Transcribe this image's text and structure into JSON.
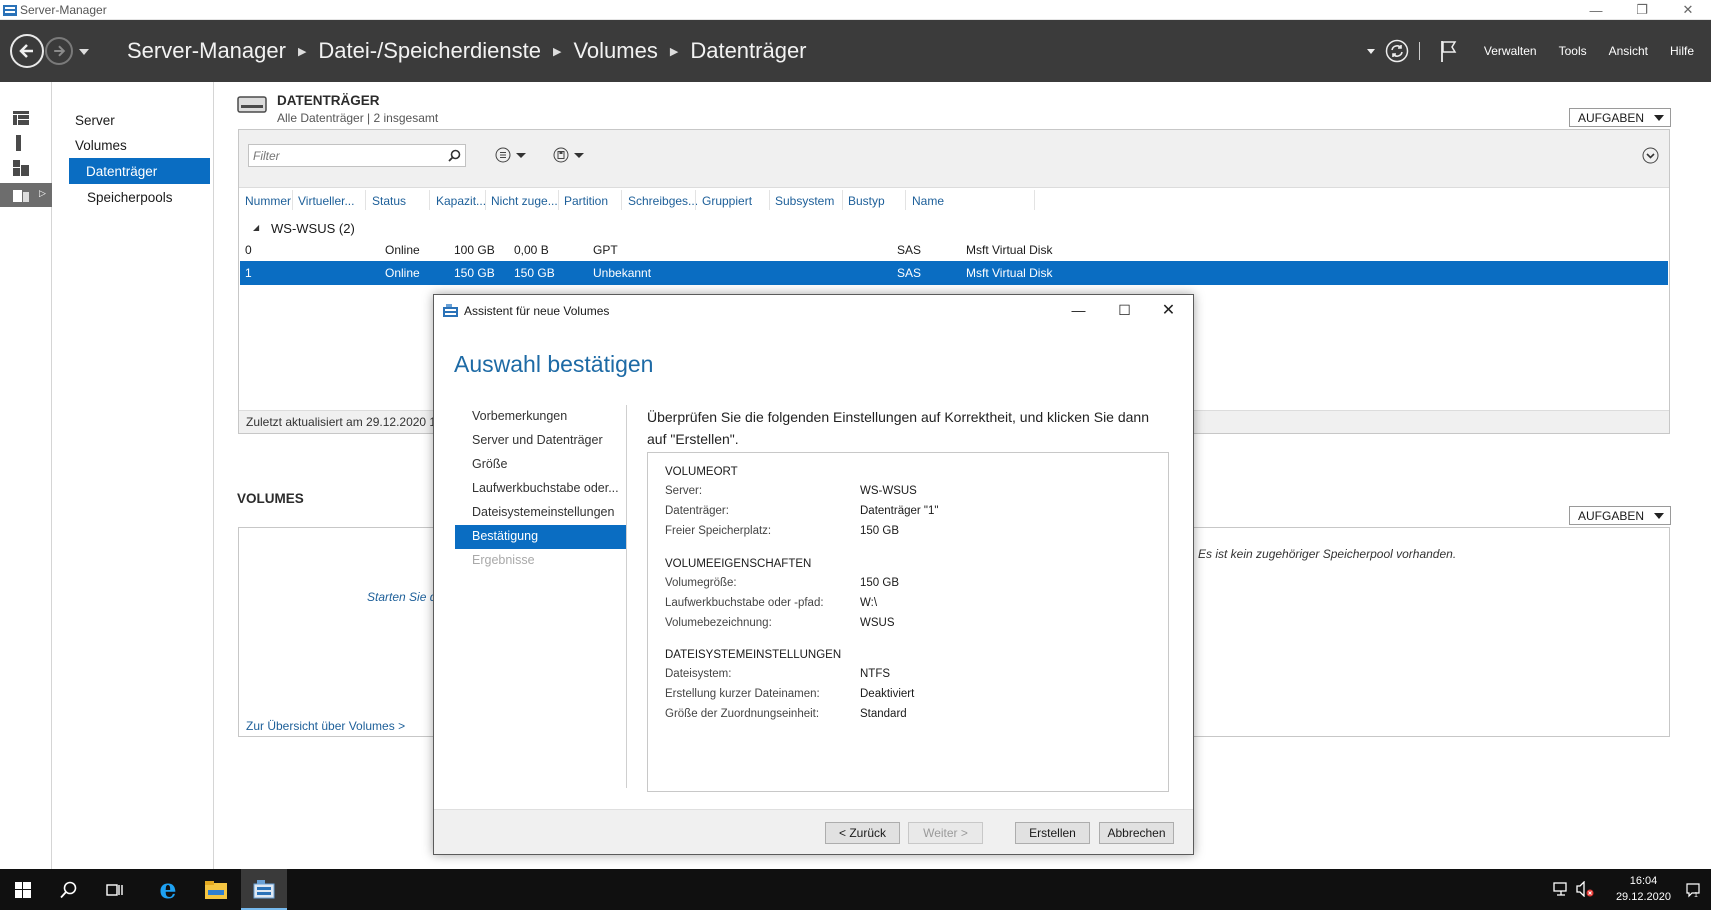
{
  "window": {
    "title": "Server-Manager"
  },
  "header": {
    "breadcrumb": [
      "Server-Manager",
      "Datei-/Speicherdienste",
      "Volumes",
      "Datenträger"
    ],
    "menu": [
      "Verwalten",
      "Tools",
      "Ansicht",
      "Hilfe"
    ]
  },
  "nav": {
    "items": [
      "Server",
      "Volumes",
      "Datenträger",
      "Speicherpools"
    ]
  },
  "disks": {
    "title": "DATENTRÄGER",
    "subtitle": "Alle Datenträger | 2 insgesamt",
    "tasks": "AUFGABEN",
    "filter_placeholder": "Filter",
    "columns": [
      "Nummer",
      "Virtueller...",
      "Status",
      "Kapazit...",
      "Nicht zuge...",
      "Partition",
      "Schreibges...",
      "Gruppiert",
      "Subsystem",
      "Bustyp",
      "Name"
    ],
    "group": "WS-WSUS (2)",
    "rows": [
      {
        "nummer": "0",
        "status": "Online",
        "kapazitaet": "100 GB",
        "nicht_zugeordnet": "0,00 B",
        "partition": "GPT",
        "bustyp": "SAS",
        "name": "Msft Virtual Disk"
      },
      {
        "nummer": "1",
        "status": "Online",
        "kapazitaet": "150 GB",
        "nicht_zugeordnet": "150 GB",
        "partition": "Unbekannt",
        "bustyp": "SAS",
        "name": "Msft Virtual Disk"
      }
    ],
    "footer": "Zuletzt aktualisiert am 29.12.2020 1"
  },
  "volumes": {
    "title": "VOLUMES",
    "tasks": "AUFGABEN",
    "start_text": "Starten Sie d",
    "pool_text": "Es ist kein zugehöriger Speicherpool vorhanden.",
    "link": "Zur Übersicht über Volumes >"
  },
  "dialog": {
    "title": "Assistent für neue Volumes",
    "heading": "Auswahl bestätigen",
    "steps": [
      "Vorbemerkungen",
      "Server und Datenträger",
      "Größe",
      "Laufwerkbuchstabe oder...",
      "Dateisystemeinstellungen",
      "Bestätigung",
      "Ergebnisse"
    ],
    "intro": "Überprüfen Sie die folgenden Einstellungen auf Korrektheit, und klicken Sie dann auf \"Erstellen\".",
    "sections": [
      {
        "heading": "VOLUMEORT",
        "rows": [
          {
            "key": "Server:",
            "value": "WS-WSUS"
          },
          {
            "key": "Datenträger:",
            "value": "Datenträger \"1\""
          },
          {
            "key": "Freier Speicherplatz:",
            "value": "150 GB"
          }
        ]
      },
      {
        "heading": "VOLUMEEIGENSCHAFTEN",
        "rows": [
          {
            "key": "Volumegröße:",
            "value": "150 GB"
          },
          {
            "key": "Laufwerkbuchstabe oder -pfad:",
            "value": "W:\\"
          },
          {
            "key": "Volumebezeichnung:",
            "value": "WSUS"
          }
        ]
      },
      {
        "heading": "DATEISYSTEMEINSTELLUNGEN",
        "rows": [
          {
            "key": "Dateisystem:",
            "value": "NTFS"
          },
          {
            "key": "Erstellung kurzer Dateinamen:",
            "value": "Deaktiviert"
          },
          {
            "key": "Größe der Zuordnungseinheit:",
            "value": "Standard"
          }
        ]
      }
    ],
    "buttons": {
      "back": "< Zurück",
      "next": "Weiter >",
      "create": "Erstellen",
      "cancel": "Abbrechen"
    }
  },
  "taskbar": {
    "time": "16:04",
    "date": "29.12.2020"
  },
  "colors": {
    "accent": "#0a6dc2",
    "header_bg": "#3b3b3b",
    "heading_blue": "#1d6aa5"
  }
}
